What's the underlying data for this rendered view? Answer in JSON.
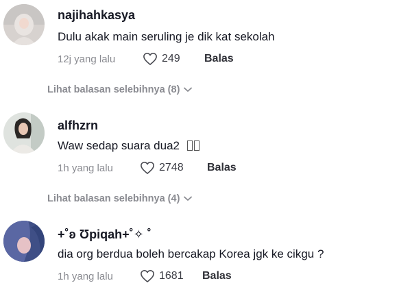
{
  "comments": [
    {
      "username": "najihahkasya",
      "text": "Dulu akak main seruling je dik kat sekolah",
      "time": "12j yang lalu",
      "likes": "249",
      "reply_label": "Balas",
      "more_replies": "Lihat balasan selebihnya (8)"
    },
    {
      "username": "alfhzrn",
      "text": "Waw sedap suara dua2",
      "time": "1h yang lalu",
      "likes": "2748",
      "reply_label": "Balas",
      "more_replies": "Lihat balasan selebihnya (4)"
    },
    {
      "username": "+˚ʚ Ʊpiqah+˚✧ ˚",
      "text": "dia org berdua boleh bercakap Korea jgk ke cikgu ?",
      "time": "1h yang lalu",
      "likes": "1681",
      "reply_label": "Balas"
    }
  ]
}
